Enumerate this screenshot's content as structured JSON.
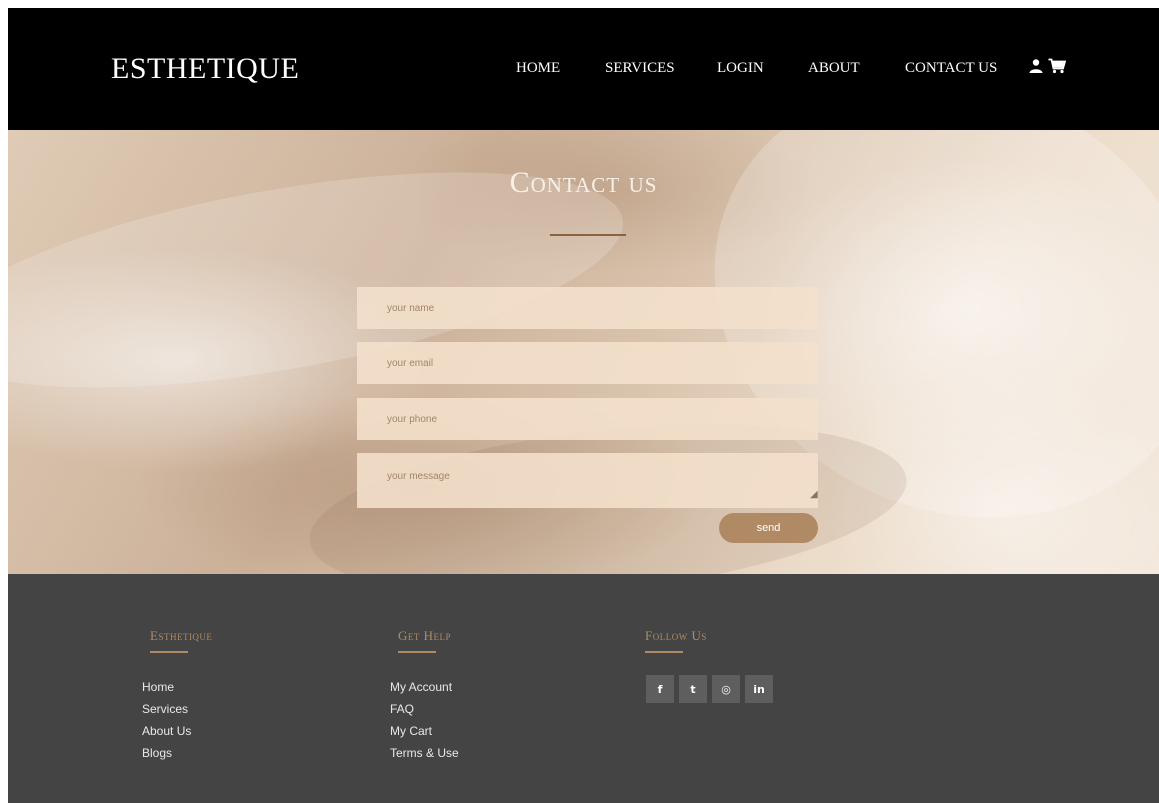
{
  "brand": "ESTHETIQUE",
  "nav": {
    "items": [
      "HOME",
      "SERVICES",
      "LOGIN",
      "ABOUT",
      "CONTACT US"
    ],
    "icons": [
      "user-icon",
      "cart-icon"
    ]
  },
  "hero": {
    "title": "Contact us"
  },
  "form": {
    "name_placeholder": "your name",
    "email_placeholder": "your email",
    "phone_placeholder": "your phone",
    "message_placeholder": "your message",
    "send_label": "send"
  },
  "footer": {
    "columns": [
      {
        "heading": "Esthetique",
        "links": [
          "Home",
          "Services",
          "About Us",
          "Blogs"
        ]
      },
      {
        "heading": "Get Help",
        "links": [
          "My Account",
          "FAQ",
          "My Cart",
          "Terms & Use"
        ]
      },
      {
        "heading": "Follow Us",
        "links": []
      }
    ],
    "social": [
      {
        "icon": "facebook-icon",
        "glyph": "f"
      },
      {
        "icon": "twitter-icon",
        "glyph": "t"
      },
      {
        "icon": "instagram-icon",
        "glyph": "◎"
      },
      {
        "icon": "linkedin-icon",
        "glyph": "in"
      }
    ]
  },
  "colors": {
    "header_bg": "#000000",
    "accent": "#b08a64",
    "footer_bg": "#444444",
    "field_bg": "#f4e0cc"
  }
}
